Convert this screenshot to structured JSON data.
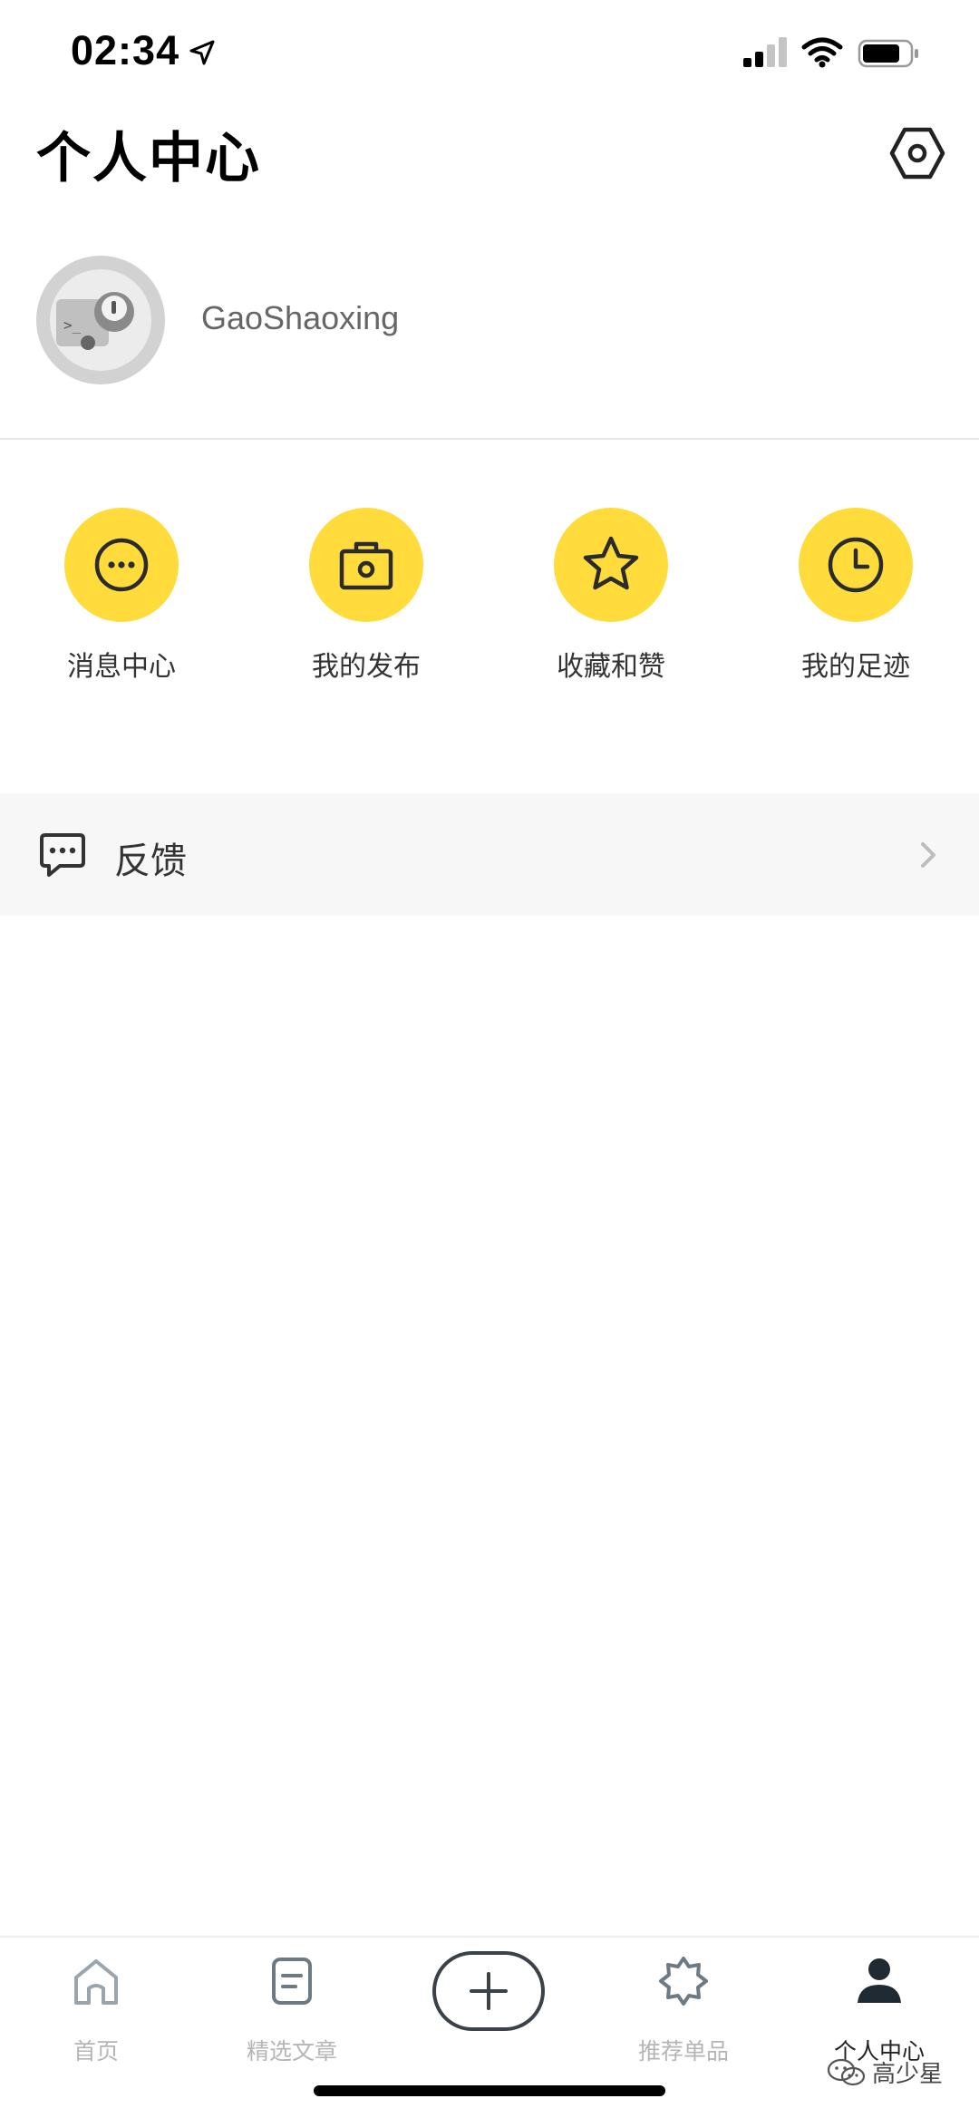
{
  "status_bar": {
    "time": "02:34"
  },
  "header": {
    "title": "个人中心"
  },
  "profile": {
    "username": "GaoShaoxing"
  },
  "actions": [
    {
      "label": "消息中心",
      "icon": "chat-dots-icon"
    },
    {
      "label": "我的发布",
      "icon": "camera-icon"
    },
    {
      "label": "收藏和赞",
      "icon": "star-icon"
    },
    {
      "label": "我的足迹",
      "icon": "clock-icon"
    }
  ],
  "feedback": {
    "label": "反馈",
    "icon": "message-dots-icon"
  },
  "tabs": [
    {
      "label": "首页",
      "icon": "home-icon",
      "active": false
    },
    {
      "label": "精选文章",
      "icon": "document-icon",
      "active": false
    },
    {
      "label": "",
      "icon": "plus-icon",
      "active": false
    },
    {
      "label": "推荐单品",
      "icon": "badge-star-icon",
      "active": false
    },
    {
      "label": "个人中心",
      "icon": "person-icon",
      "active": true
    }
  ],
  "watermark": {
    "text": "高少星"
  },
  "colors": {
    "accent": "#ffdc3c",
    "tab_inactive": "#b5b5b5",
    "tab_active": "#222222",
    "feedback_bg": "#f7f7f7"
  }
}
